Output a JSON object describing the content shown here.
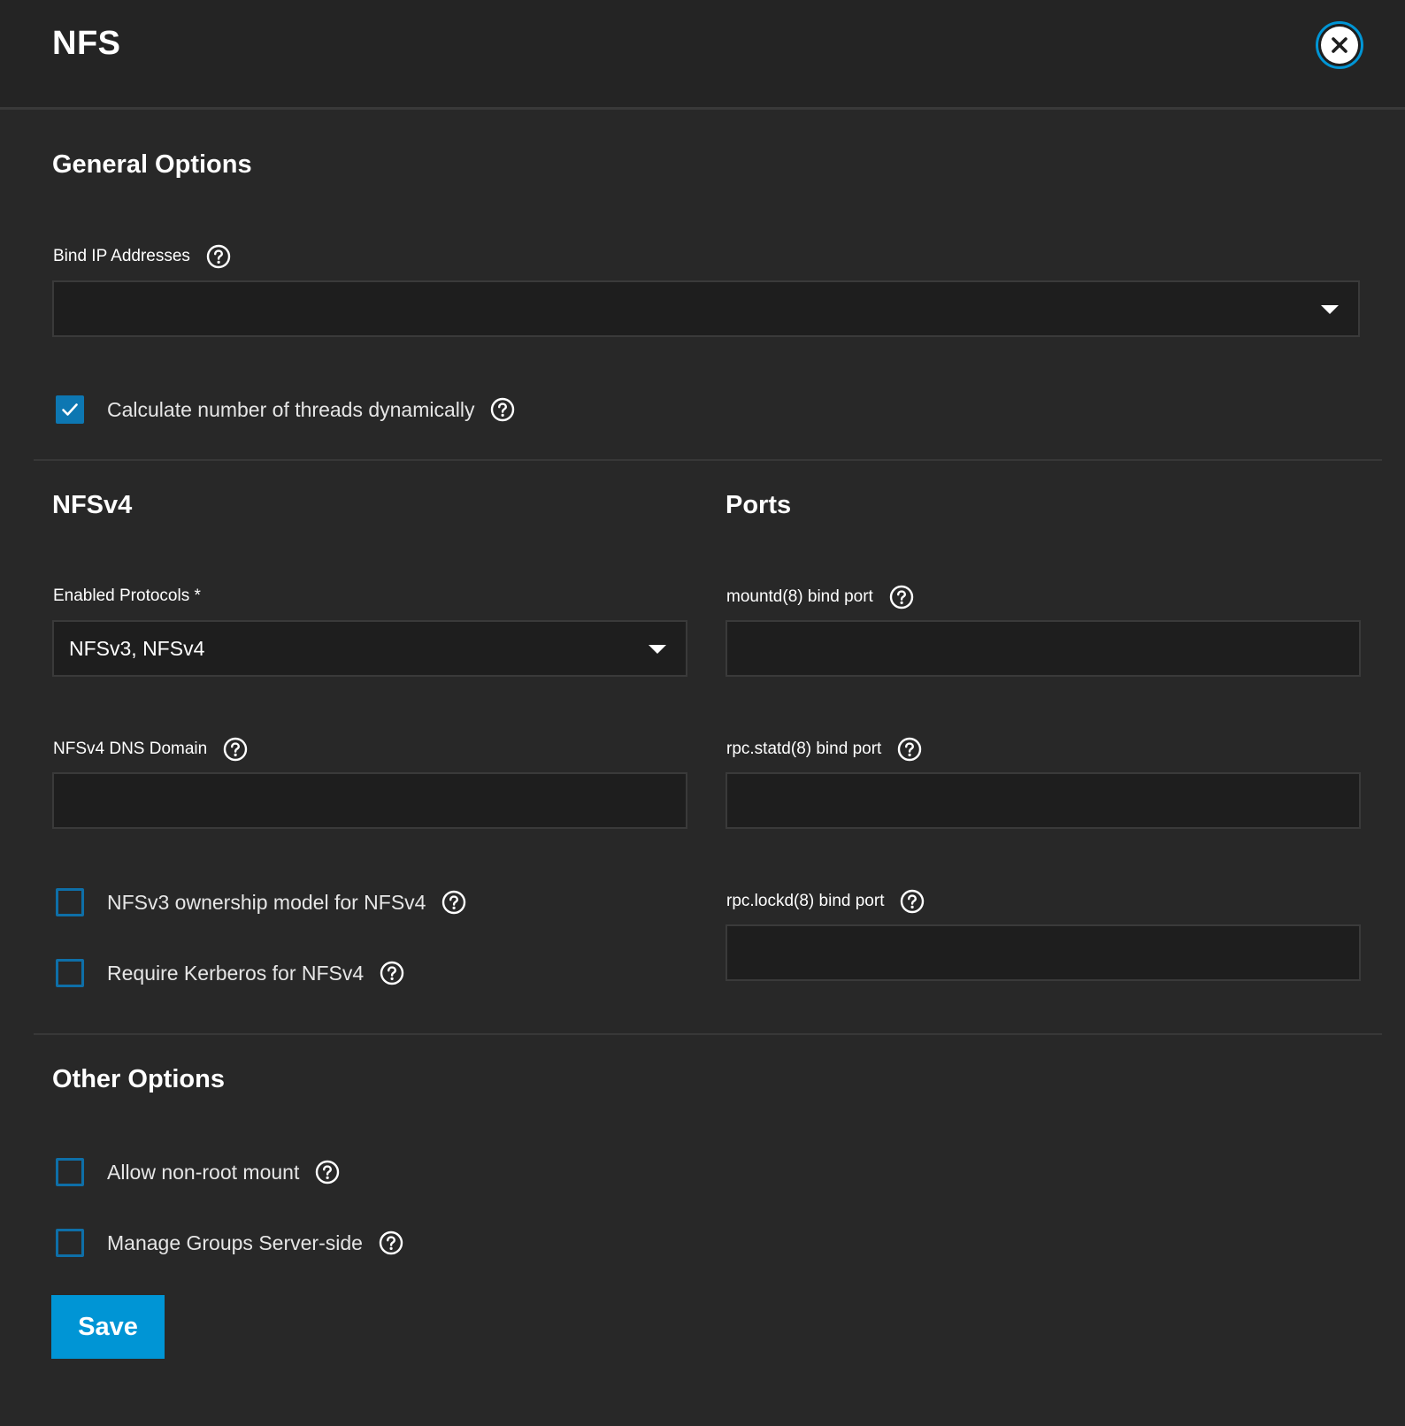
{
  "header": {
    "title": "NFS",
    "close_icon": "close-icon"
  },
  "general": {
    "title": "General Options",
    "bind_ip": {
      "label": "Bind IP Addresses",
      "value": ""
    },
    "threads": {
      "label": "Calculate number of threads dynamically",
      "checked": true
    }
  },
  "nfsv4": {
    "title": "NFSv4",
    "protocols": {
      "label": "Enabled Protocols *",
      "value": "NFSv3, NFSv4"
    },
    "dns_domain": {
      "label": "NFSv4 DNS Domain",
      "value": ""
    },
    "ownership": {
      "label": "NFSv3 ownership model for NFSv4",
      "checked": false
    },
    "kerberos": {
      "label": "Require Kerberos for NFSv4",
      "checked": false
    }
  },
  "ports": {
    "title": "Ports",
    "mountd": {
      "label": "mountd(8) bind port",
      "value": ""
    },
    "statd": {
      "label": "rpc.statd(8) bind port",
      "value": ""
    },
    "lockd": {
      "label": "rpc.lockd(8) bind port",
      "value": ""
    }
  },
  "other": {
    "title": "Other Options",
    "non_root": {
      "label": "Allow non-root mount",
      "checked": false
    },
    "manage_groups": {
      "label": "Manage Groups Server-side",
      "checked": false
    }
  },
  "actions": {
    "save_label": "Save"
  },
  "colors": {
    "accent": "#0095d5",
    "background": "#282828",
    "input_background": "#1e1e1e"
  }
}
